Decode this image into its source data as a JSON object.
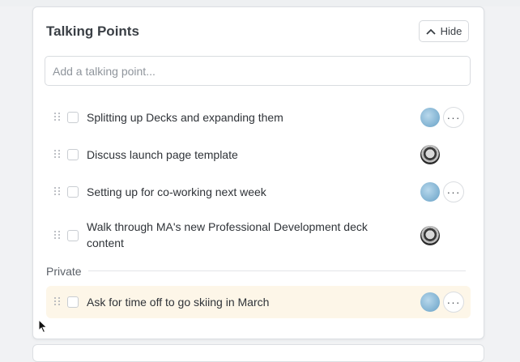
{
  "panel": {
    "title": "Talking Points",
    "hide_label": "Hide"
  },
  "add_input": {
    "placeholder": "Add a talking point..."
  },
  "items": [
    {
      "text": "Splitting up Decks and expanding them",
      "avatar": "blue",
      "has_menu": true
    },
    {
      "text": "Discuss launch page template",
      "avatar": "dark",
      "has_menu": false
    },
    {
      "text": "Setting up for co-working next week",
      "avatar": "blue",
      "has_menu": true
    },
    {
      "text": "Walk through MA's new Professional Development deck content",
      "avatar": "dark",
      "has_menu": false
    }
  ],
  "private_section": {
    "label": "Private",
    "items": [
      {
        "text": "Ask for time off to go skiing in March",
        "avatar": "blue",
        "has_menu": true
      }
    ]
  },
  "menu_glyph": "···",
  "colors": {
    "highlight_row": "#fdf6e8",
    "card_background": "#ffffff",
    "page_background": "#f1f2f4"
  }
}
